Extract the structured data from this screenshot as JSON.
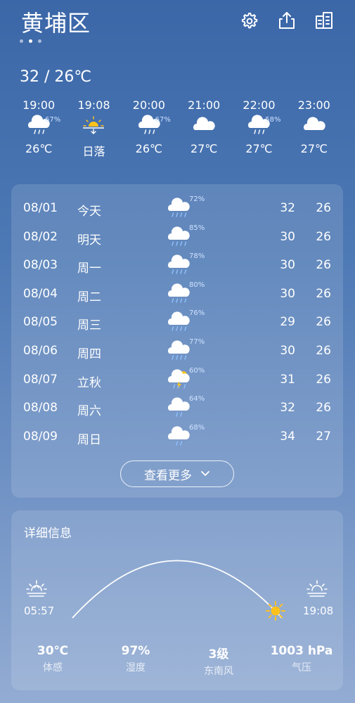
{
  "header": {
    "city": "黄埔区",
    "hi_lo": "32 / 26℃"
  },
  "hourly": [
    {
      "time": "19:00",
      "icon": "rain-cloud-icon",
      "precip": "67%",
      "value": "26℃"
    },
    {
      "time": "19:08",
      "icon": "sunset-icon",
      "precip": "",
      "value": "日落"
    },
    {
      "time": "20:00",
      "icon": "rain-cloud-icon",
      "precip": "67%",
      "value": "26℃"
    },
    {
      "time": "21:00",
      "icon": "cloud-icon",
      "precip": "",
      "value": "27℃"
    },
    {
      "time": "22:00",
      "icon": "rain-cloud-icon",
      "precip": "58%",
      "value": "27℃"
    },
    {
      "time": "23:00",
      "icon": "cloud-icon",
      "precip": "",
      "value": "27℃"
    }
  ],
  "daily": [
    {
      "date": "08/01",
      "name": "今天",
      "icon": "heavy-rain-icon",
      "precip": "72%",
      "hi": "32",
      "lo": "26"
    },
    {
      "date": "08/02",
      "name": "明天",
      "icon": "heavy-rain-icon",
      "precip": "85%",
      "hi": "30",
      "lo": "26"
    },
    {
      "date": "08/03",
      "name": "周一",
      "icon": "heavy-rain-icon",
      "precip": "78%",
      "hi": "30",
      "lo": "26"
    },
    {
      "date": "08/04",
      "name": "周二",
      "icon": "heavy-rain-icon",
      "precip": "80%",
      "hi": "30",
      "lo": "26"
    },
    {
      "date": "08/05",
      "name": "周三",
      "icon": "heavy-rain-icon",
      "precip": "76%",
      "hi": "29",
      "lo": "26"
    },
    {
      "date": "08/06",
      "name": "周四",
      "icon": "heavy-rain-icon",
      "precip": "77%",
      "hi": "30",
      "lo": "26"
    },
    {
      "date": "08/07",
      "name": "立秋",
      "icon": "thunderstorm-icon",
      "precip": "60%",
      "hi": "31",
      "lo": "26"
    },
    {
      "date": "08/08",
      "name": "周六",
      "icon": "light-rain-icon",
      "precip": "64%",
      "hi": "32",
      "lo": "26"
    },
    {
      "date": "08/09",
      "name": "周日",
      "icon": "light-rain-icon",
      "precip": "68%",
      "hi": "34",
      "lo": "27"
    }
  ],
  "more_button": "查看更多",
  "details": {
    "title": "详细信息",
    "sunrise": "05:57",
    "sunset": "19:08",
    "stats": [
      {
        "value": "30℃",
        "label": "体感"
      },
      {
        "value": "97%",
        "label": "湿度"
      },
      {
        "value": "3级",
        "label": "东南风"
      },
      {
        "value": "1003 hPa",
        "label": "气压"
      }
    ]
  },
  "colors": {
    "bg_top": "#3b67a8",
    "bg_bottom": "#93acd3",
    "sun": "#ffc21a",
    "precip_text": "#cfe2ff"
  }
}
